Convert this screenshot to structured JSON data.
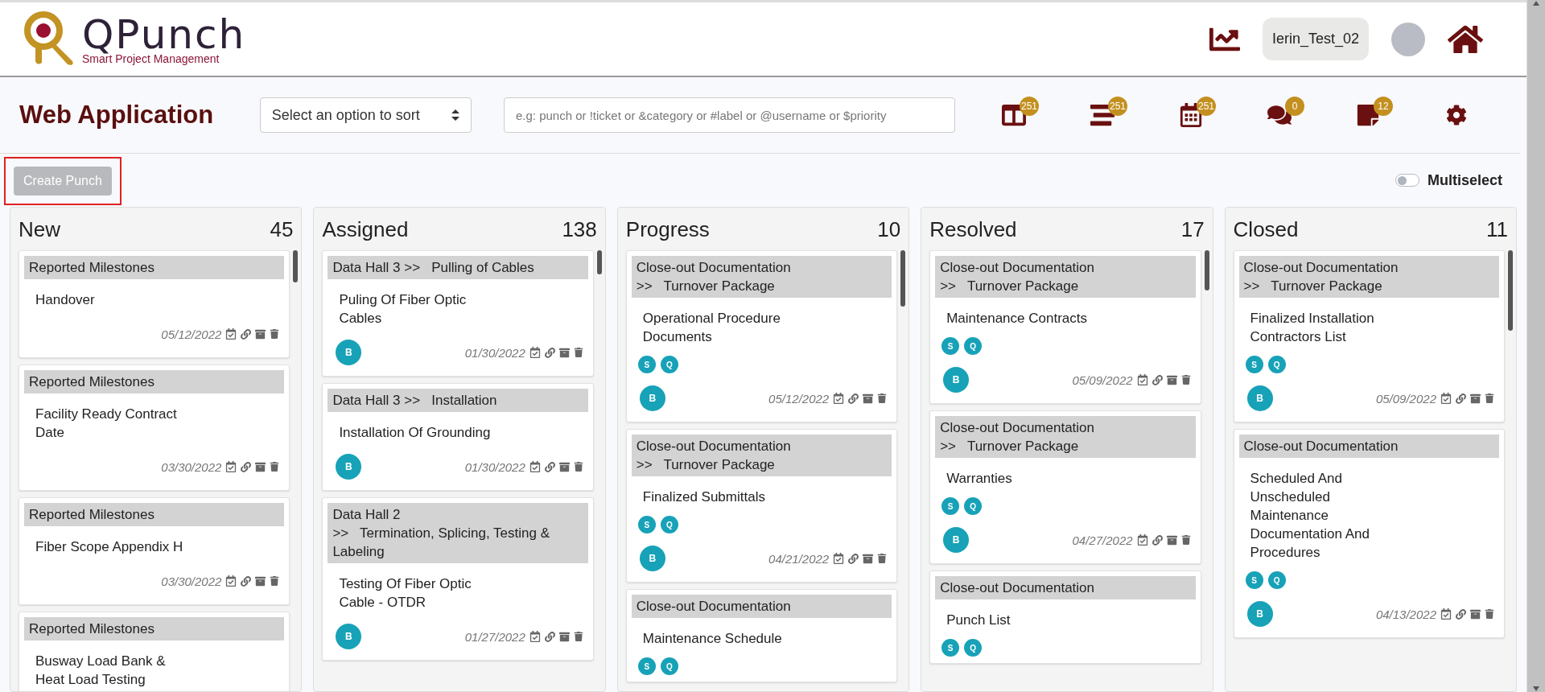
{
  "header": {
    "brand": "QPunch",
    "tagline": "Smart Project Management",
    "username": "Ierin_Test_02"
  },
  "toolbar": {
    "title": "Web Application",
    "sort_select": {
      "value": "Select an option to sort"
    },
    "search": {
      "placeholder": "e.g: punch or !ticket or &category or #label or @username or $priority"
    },
    "buttons": [
      {
        "kind": "board",
        "badge": "251"
      },
      {
        "kind": "list",
        "badge": "251"
      },
      {
        "kind": "calendar",
        "badge": "251"
      },
      {
        "kind": "comments",
        "badge": "0"
      },
      {
        "kind": "notes",
        "badge": "12"
      },
      {
        "kind": "settings"
      }
    ]
  },
  "create_button": {
    "label": "Create Punch",
    "disabled": true
  },
  "multiselect": {
    "label": "Multiselect",
    "on": false
  },
  "columns": [
    {
      "title": "New",
      "count": "45",
      "cards": [
        {
          "category": "Reported Milestones",
          "title": "Handover",
          "date": "05/12/2022"
        },
        {
          "category": "Reported Milestones",
          "title": "Facility Ready Contract Date",
          "date": "03/30/2022"
        },
        {
          "category": "Reported Milestones",
          "title": "Fiber Scope Appendix H",
          "date": "03/30/2022"
        },
        {
          "category": "Reported Milestones",
          "title": "Busway Load Bank & Heat Load Testing"
        }
      ]
    },
    {
      "title": "Assigned",
      "count": "138",
      "cards": [
        {
          "category": "Data Hall 3 >>   Pulling of Cables",
          "title": "Puling Of Fiber Optic Cables",
          "assignee": "B",
          "date": "01/30/2022"
        },
        {
          "category": "Data Hall 3 >>   Installation",
          "title": "Installation Of Grounding",
          "assignee": "B",
          "date": "01/30/2022"
        },
        {
          "category": "Data Hall 2",
          "subcategory": ">>   Termination, Splicing, Testing & Labeling",
          "title": "Testing Of Fiber Optic Cable - OTDR",
          "assignee": "B",
          "date": "01/27/2022"
        }
      ]
    },
    {
      "title": "Progress",
      "count": "10",
      "cards": [
        {
          "category": "Close-out Documentation",
          "subcategory": ">>   Turnover Package",
          "title": "Operational Procedure Documents",
          "tags": [
            "S",
            "Q"
          ],
          "assignee": "B",
          "date": "05/12/2022"
        },
        {
          "category": "Close-out Documentation",
          "subcategory": ">>   Turnover Package",
          "title": "Finalized Submittals",
          "tags": [
            "S",
            "Q"
          ],
          "assignee": "B",
          "date": "04/21/2022"
        },
        {
          "category": "Close-out Documentation",
          "title": "Maintenance Schedule",
          "tags": [
            "S",
            "Q"
          ]
        }
      ]
    },
    {
      "title": "Resolved",
      "count": "17",
      "cards": [
        {
          "category": "Close-out Documentation",
          "subcategory": ">>   Turnover Package",
          "title": "Maintenance Contracts",
          "tags": [
            "S",
            "Q"
          ],
          "assignee": "B",
          "date": "05/09/2022"
        },
        {
          "category": "Close-out Documentation",
          "subcategory": ">>   Turnover Package",
          "title": "Warranties",
          "tags": [
            "S",
            "Q"
          ],
          "assignee": "B",
          "date": "04/27/2022"
        },
        {
          "category": "Close-out Documentation",
          "title": "Punch List",
          "tags": [
            "S",
            "Q"
          ]
        }
      ]
    },
    {
      "title": "Closed",
      "count": "11",
      "cards": [
        {
          "category": "Close-out Documentation",
          "subcategory": ">>   Turnover Package",
          "title": "Finalized Installation Contractors List",
          "tags": [
            "S",
            "Q"
          ],
          "assignee": "B",
          "date": "05/09/2022"
        },
        {
          "category": "Close-out Documentation",
          "title": "Scheduled And Unscheduled Maintenance Documentation And Procedures",
          "tags": [
            "S",
            "Q"
          ],
          "assignee": "B",
          "date": "04/13/2022"
        }
      ]
    }
  ]
}
